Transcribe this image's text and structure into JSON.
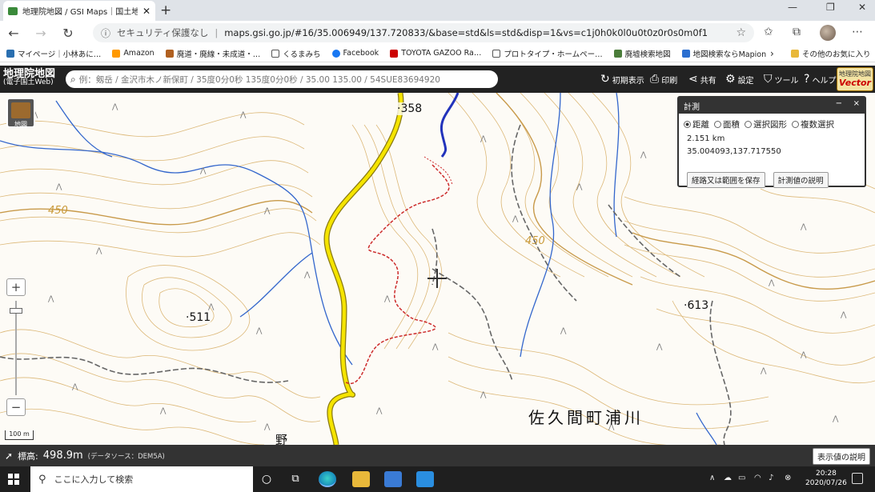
{
  "browser": {
    "tab_title": "地理院地図 / GSI Maps｜国土地…",
    "address_warning": "セキュリティ保護なし",
    "address_sep": "|",
    "url": "maps.gsi.go.jp/#16/35.006949/137.720833/&base=std&ls=std&disp=1&vs=c1j0h0k0l0u0t0z0r0s0m0f1",
    "bookmarks": [
      "マイページ｜小林あに…",
      "Amazon",
      "廃道・廃線・未成道・…",
      "くるまみち",
      "Facebook",
      "TOYOTA GAZOO Ra…",
      "プロトタイプ・ホームペー…",
      "廃墟検索地図",
      "地図検索ならMapion"
    ],
    "other_bookmarks": "その他のお気に入り",
    "bookmark_colors": [
      "#2a6fb0",
      "#ff9900",
      "#b06020",
      "#555555",
      "#1877f2",
      "#cc0000",
      "#555555",
      "#4b7d3a",
      "#2c6fd0"
    ]
  },
  "gsi": {
    "logo_line1": "地理院地図",
    "logo_line2": "(電子国土Web)",
    "search_placeholder": "例：剱岳 / 金沢市木ノ新保町 / 35度0分0秒 135度0分0秒 / 35.00 135.00 / 54SUE83694920",
    "header_buttons": [
      "初期表示",
      "印刷",
      "共有",
      "設定",
      "ツール",
      "ヘルプ"
    ],
    "vector_line1": "地理院地図",
    "vector_line2": "Vector"
  },
  "map": {
    "toggle_label": "地図",
    "zoom_in": "+",
    "zoom_out": "−",
    "zoom_level_fraction": 0.08,
    "scale_label": "100 m",
    "elevation_labels": [
      "358",
      "511",
      "613"
    ],
    "contour_labels": [
      "450",
      "450"
    ],
    "place_name": "佐久間町浦川",
    "partial_label": "野 瀬"
  },
  "measure": {
    "title": "計測",
    "minimize": "−",
    "close": "×",
    "options": [
      "距離",
      "面積",
      "選択図形",
      "複数選択"
    ],
    "selected_option": "距離",
    "distance": "2.151 km",
    "coordinate": "35.004093,137.717550",
    "save_button": "経路又は範囲を保存",
    "explain_button": "計測値の説明"
  },
  "statusbar": {
    "elevation_label": "標高:",
    "elevation_value": "498.9m",
    "source": "(データソース：DEM5A)",
    "explain_button": "表示値の説明"
  },
  "taskbar": {
    "search_placeholder": "ここに入力して検索",
    "time": "20:28",
    "date": "2020/07/26"
  }
}
